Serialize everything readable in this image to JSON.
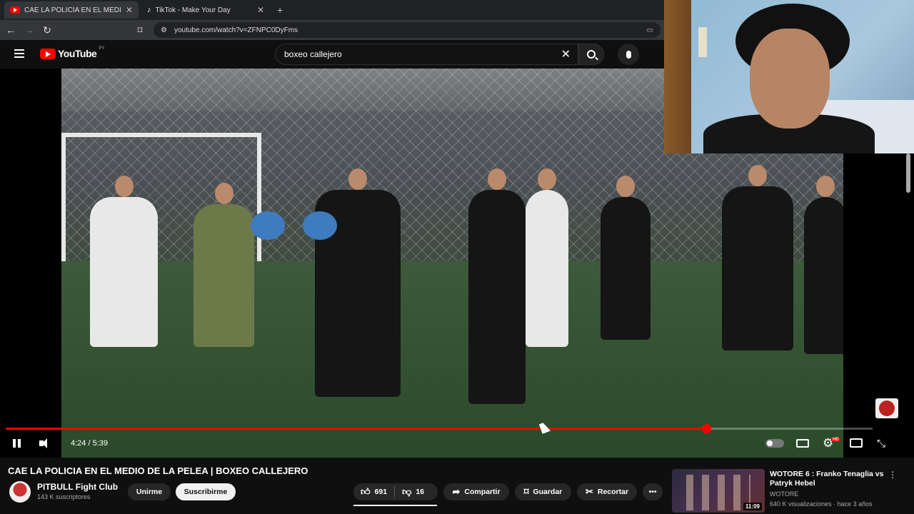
{
  "browser": {
    "tabs": [
      {
        "title": "CAE LA POLICIA EN EL MEDIO",
        "close": "✕",
        "active": true
      },
      {
        "title": "TikTok - Make Your Day",
        "close": "✕",
        "active": false
      }
    ],
    "new_tab": "+",
    "nav": {
      "back": "←",
      "forward": "→",
      "reload": "↻"
    },
    "url": "youtube.com/watch?v=ZFNPC0DyFms"
  },
  "youtube": {
    "logo_text": "YouTube",
    "country_code": "PY",
    "search_value": "boxeo callejero",
    "clear": "✕"
  },
  "player": {
    "time": "4:24 / 5:39",
    "progress_fraction": 0.808,
    "hd_badge": "HD",
    "settings": "⚙",
    "fullscreen": "⤡"
  },
  "video": {
    "title": "CAE LA POLICIA EN EL MEDIO DE LA PELEA | BOXEO CALLEJERO",
    "channel": "PITBULL Fight Club",
    "subscribers": "143 K suscriptores",
    "join_label": "Unirme",
    "subscribe_label": "Suscribirme",
    "likes": "691",
    "dislikes": "16",
    "share_label": "Compartir",
    "save_label": "Guardar",
    "clip_label": "Recortar",
    "more": "•••"
  },
  "recommended": {
    "title": "WOTORE 6 : Franko Tenaglia vs Patryk Hebel",
    "channel": "WOTORE",
    "meta": "640 K visualizaciones · hace 3 años",
    "duration": "11:09",
    "more": "⋮"
  },
  "colors": {
    "accent": "#ff0000",
    "background": "#0f0f0f"
  }
}
